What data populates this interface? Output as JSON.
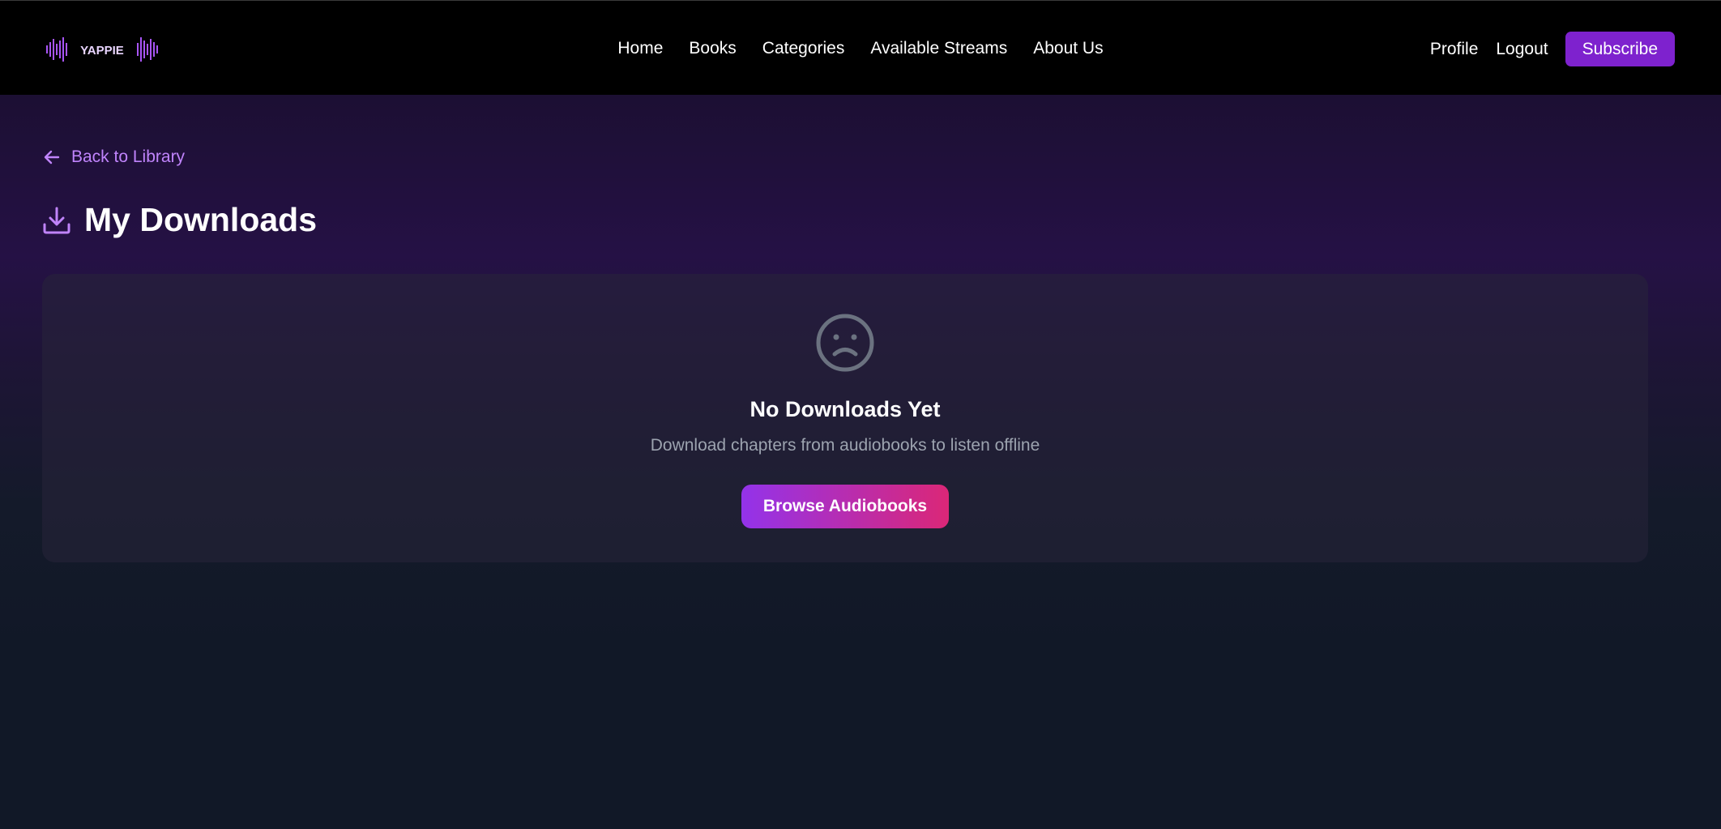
{
  "brand": {
    "logo_text": "YAPPIE",
    "logo_icon": "waveform-icon",
    "accent_color": "#a855f7"
  },
  "nav": {
    "links": [
      {
        "label": "Home"
      },
      {
        "label": "Books"
      },
      {
        "label": "Categories"
      },
      {
        "label": "Available Streams"
      },
      {
        "label": "About Us"
      }
    ],
    "profile_label": "Profile",
    "logout_label": "Logout",
    "subscribe_label": "Subscribe"
  },
  "page": {
    "back_label": "Back to Library",
    "back_icon": "arrow-left-icon",
    "title": "My Downloads",
    "title_icon": "download-icon"
  },
  "empty_state": {
    "icon": "sad-face-icon",
    "title": "No Downloads Yet",
    "subtitle": "Download chapters from audiobooks to listen offline",
    "button_label": "Browse Audiobooks"
  },
  "colors": {
    "nav_bg": "#000000",
    "subscribe_bg": "#7e22ce",
    "link_accent": "#c084fc",
    "button_gradient_start": "#9333ea",
    "button_gradient_end": "#db2777",
    "page_bg": "#111827"
  }
}
